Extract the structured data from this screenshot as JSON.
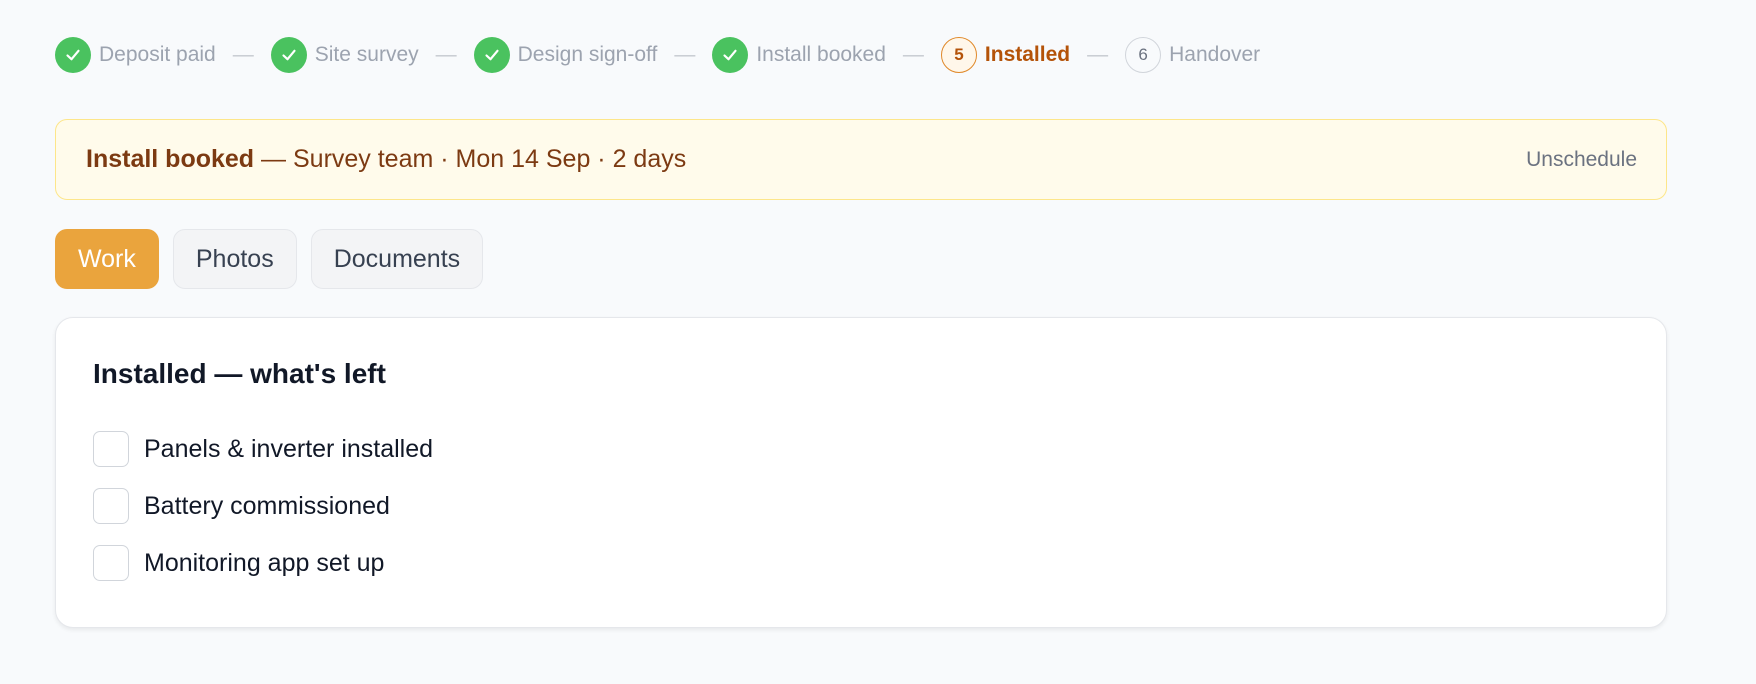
{
  "stepper": {
    "steps": [
      {
        "label": "Deposit paid",
        "state": "done"
      },
      {
        "label": "Site survey",
        "state": "done"
      },
      {
        "label": "Design sign-off",
        "state": "done"
      },
      {
        "label": "Install booked",
        "state": "done"
      },
      {
        "label": "Installed",
        "number": "5",
        "state": "current"
      },
      {
        "label": "Handover",
        "number": "6",
        "state": "pending"
      }
    ],
    "separator": "—"
  },
  "banner": {
    "title": "Install booked",
    "details": " — Survey team · Mon 14 Sep · 2 days",
    "action_label": "Unschedule"
  },
  "tabs": [
    {
      "label": "Work",
      "active": true
    },
    {
      "label": "Photos",
      "active": false
    },
    {
      "label": "Documents",
      "active": false
    }
  ],
  "card": {
    "title": "Installed — what's left",
    "items": [
      {
        "label": "Panels & inverter installed",
        "checked": false
      },
      {
        "label": "Battery commissioned",
        "checked": false
      },
      {
        "label": "Monitoring app set up",
        "checked": false
      }
    ]
  },
  "colors": {
    "done": "#4ac25f",
    "current": "#b45309",
    "accent": "#eaa43d",
    "banner_bg": "#fffbeb",
    "banner_text": "#7c3a12"
  }
}
